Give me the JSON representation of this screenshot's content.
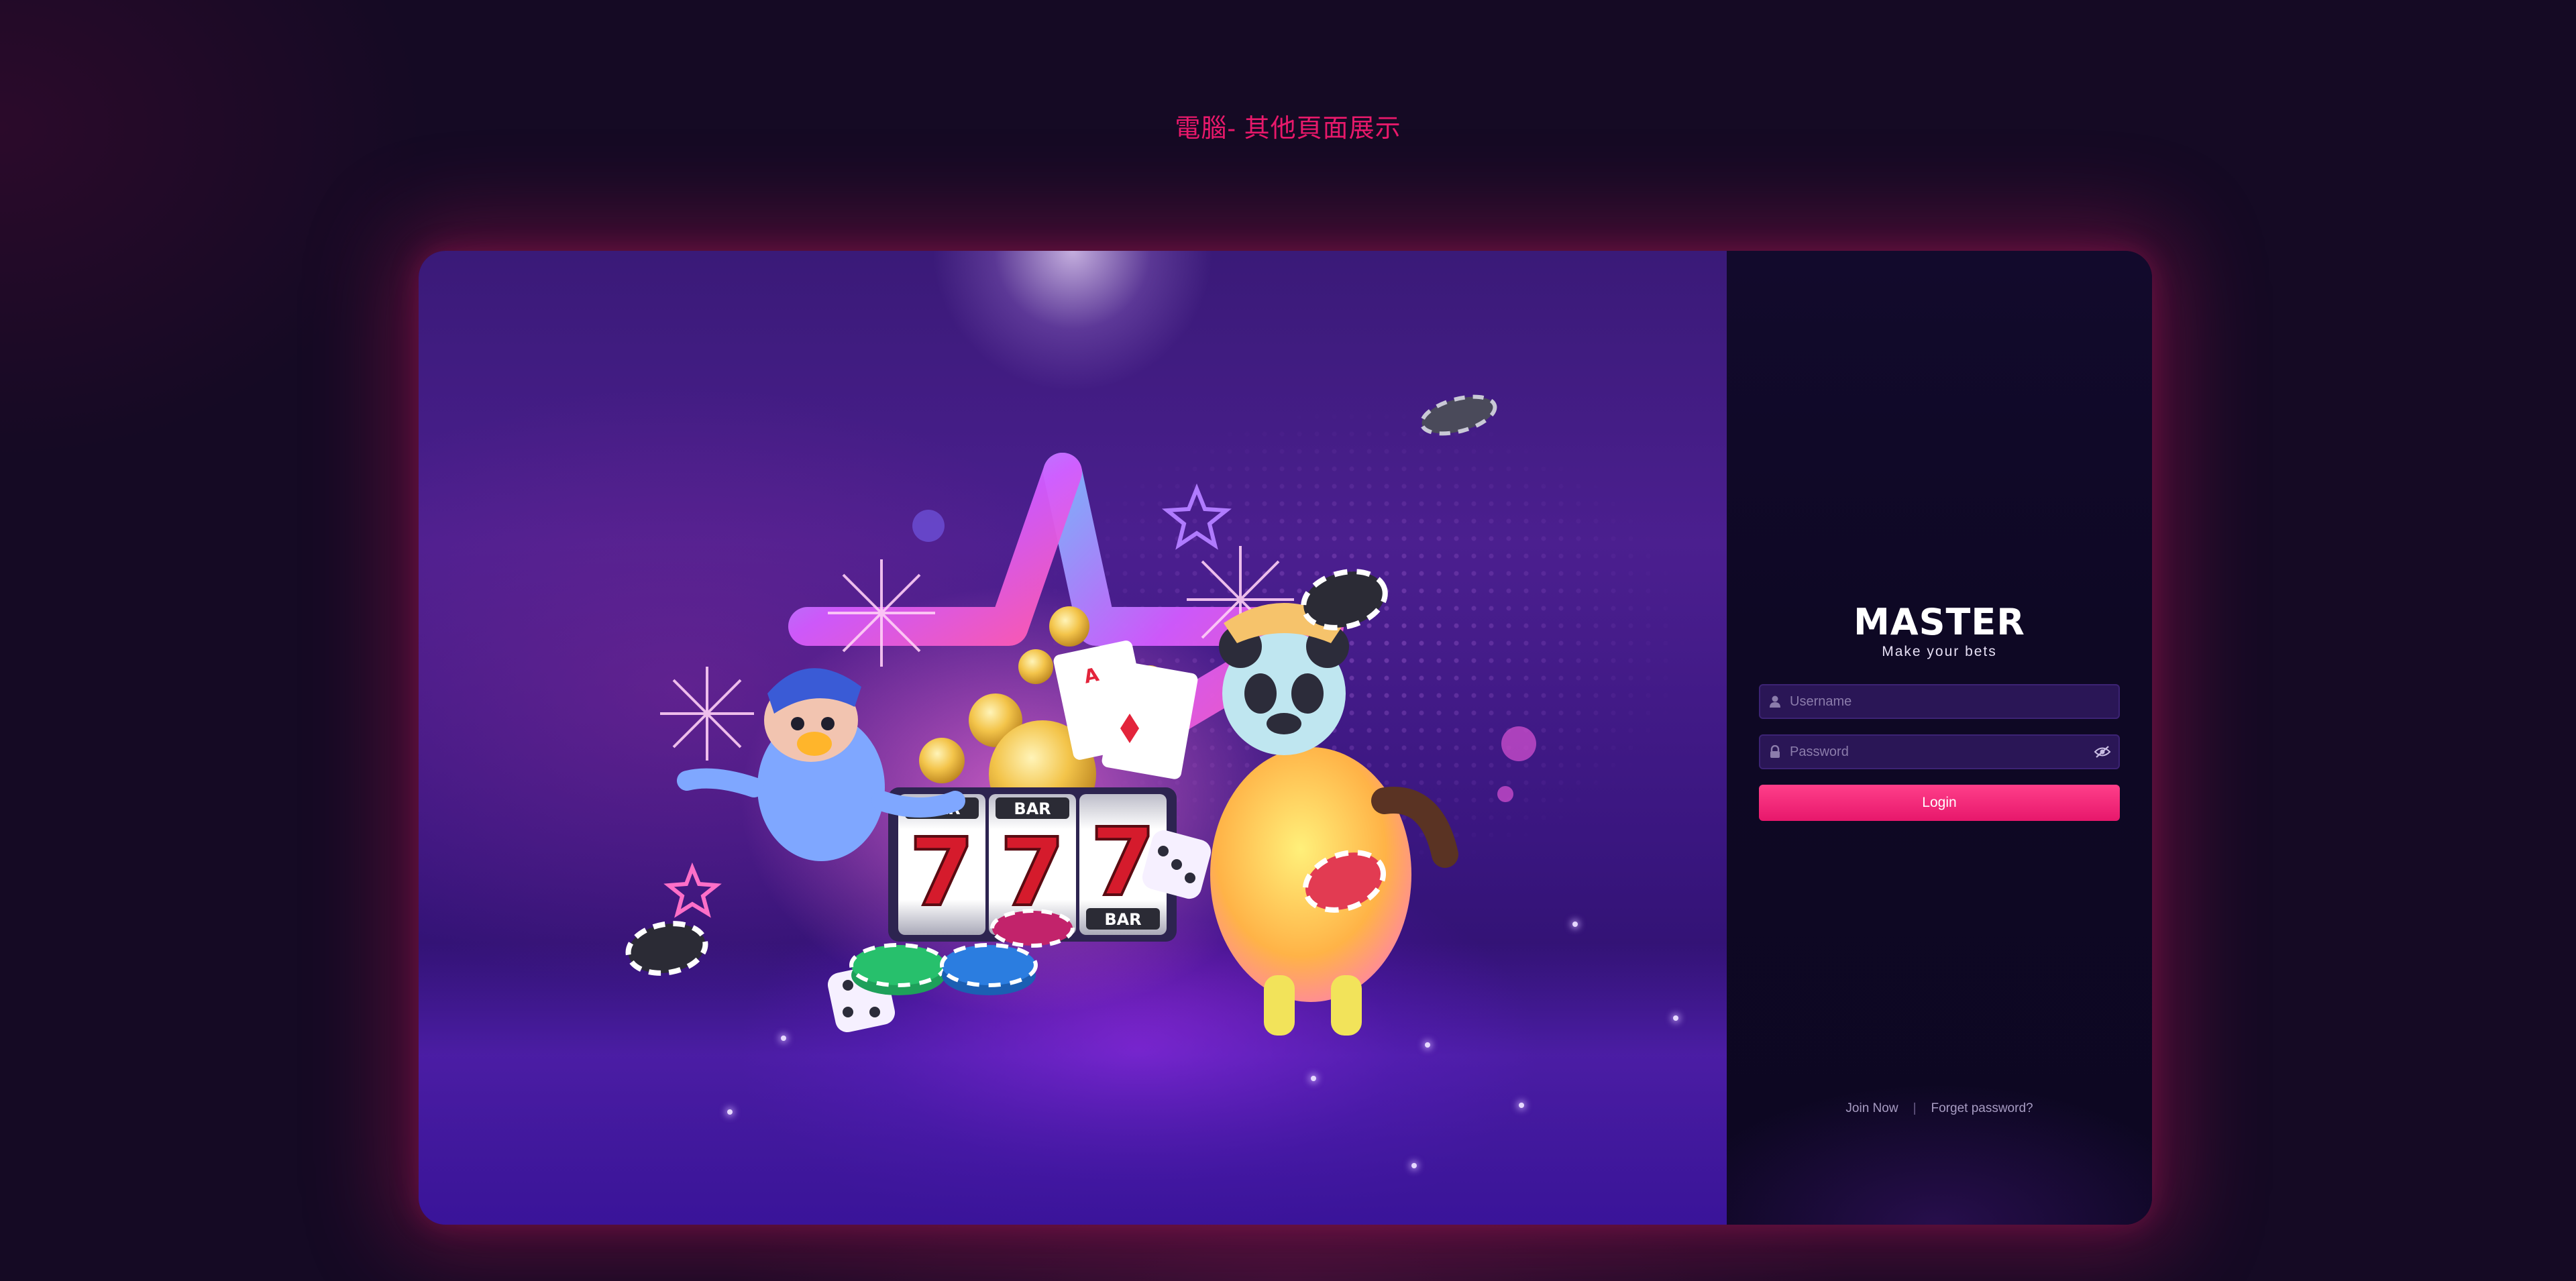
{
  "page": {
    "caption": "電腦- 其他頁面展示"
  },
  "login": {
    "brand": "MASTER",
    "tagline": "Make your bets",
    "username": {
      "placeholder": "Username",
      "value": "",
      "icon": "user-icon"
    },
    "password": {
      "placeholder": "Password",
      "value": "",
      "icon": "lock-icon",
      "toggle_icon": "eye-off-icon"
    },
    "login_label": "Login",
    "join_label": "Join Now",
    "separator": "|",
    "forgot_label": "Forget password?"
  },
  "hero": {
    "reel_labels": [
      "BAR",
      "BAR",
      "BAR"
    ],
    "reel_symbols": [
      "7",
      "7",
      "7"
    ]
  },
  "colors": {
    "accent": "#e8196b",
    "panel_bg": "#0e0824",
    "field_bg": "#2a1656"
  }
}
